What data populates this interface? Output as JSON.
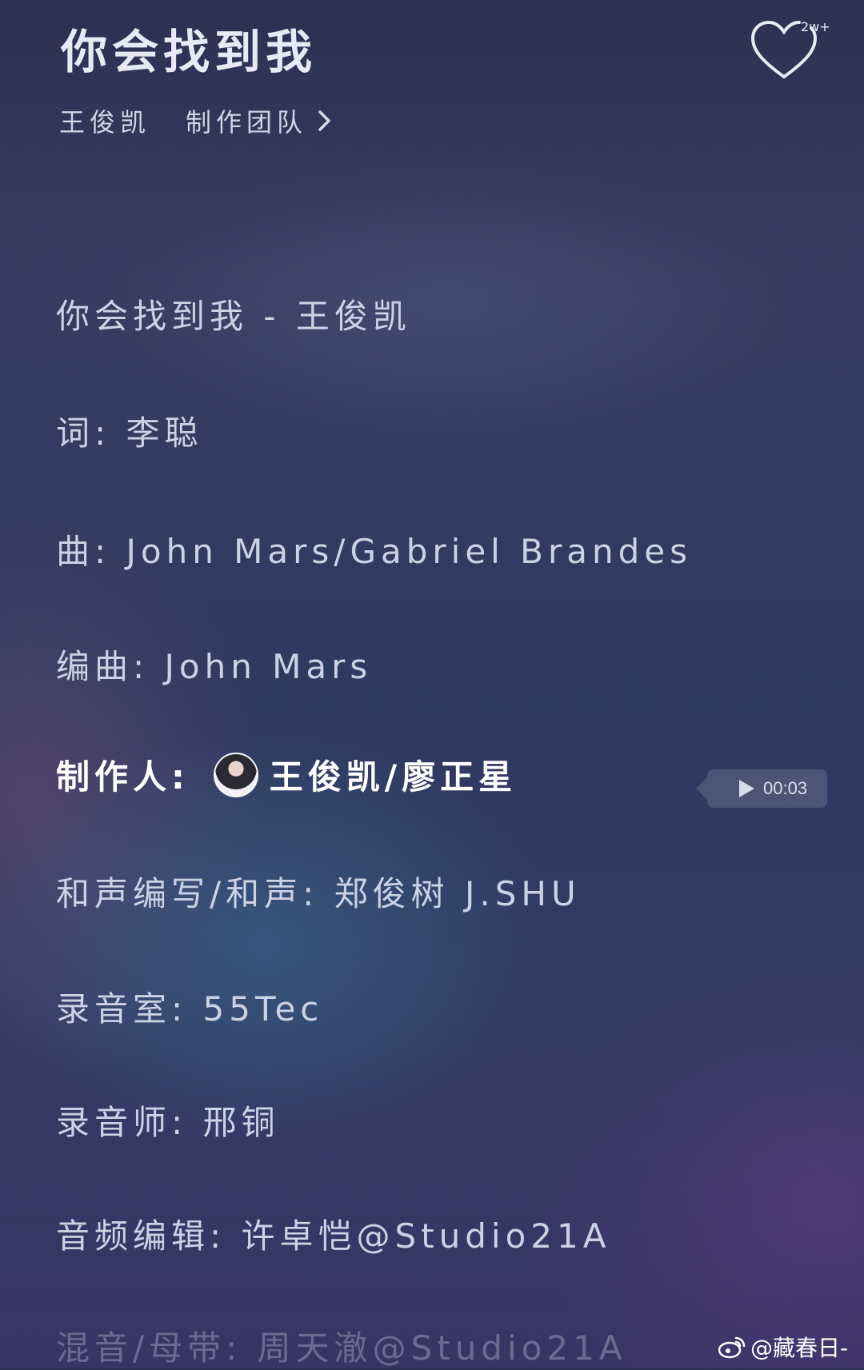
{
  "header": {
    "song_title": "你会找到我",
    "artist": "王俊凯",
    "team_link": "制作团队",
    "like_count": "2w+"
  },
  "credits": [
    "你会找到我 - 王俊凯",
    "词: 李聪",
    "曲: John Mars/Gabriel Brandes",
    "编曲: John Mars",
    "制作人:",
    "和声编写/和声: 郑俊树 J.SHU",
    "录音室: 55Tec",
    "录音师: 邢铜",
    "音频编辑: 许卓恺@Studio21A",
    "混音/母带: 周天澈@Studio21A"
  ],
  "producer_names": "王俊凯/廖正星",
  "play_pill": {
    "time": "00:03"
  },
  "watermark": {
    "text": "@藏春日-"
  }
}
